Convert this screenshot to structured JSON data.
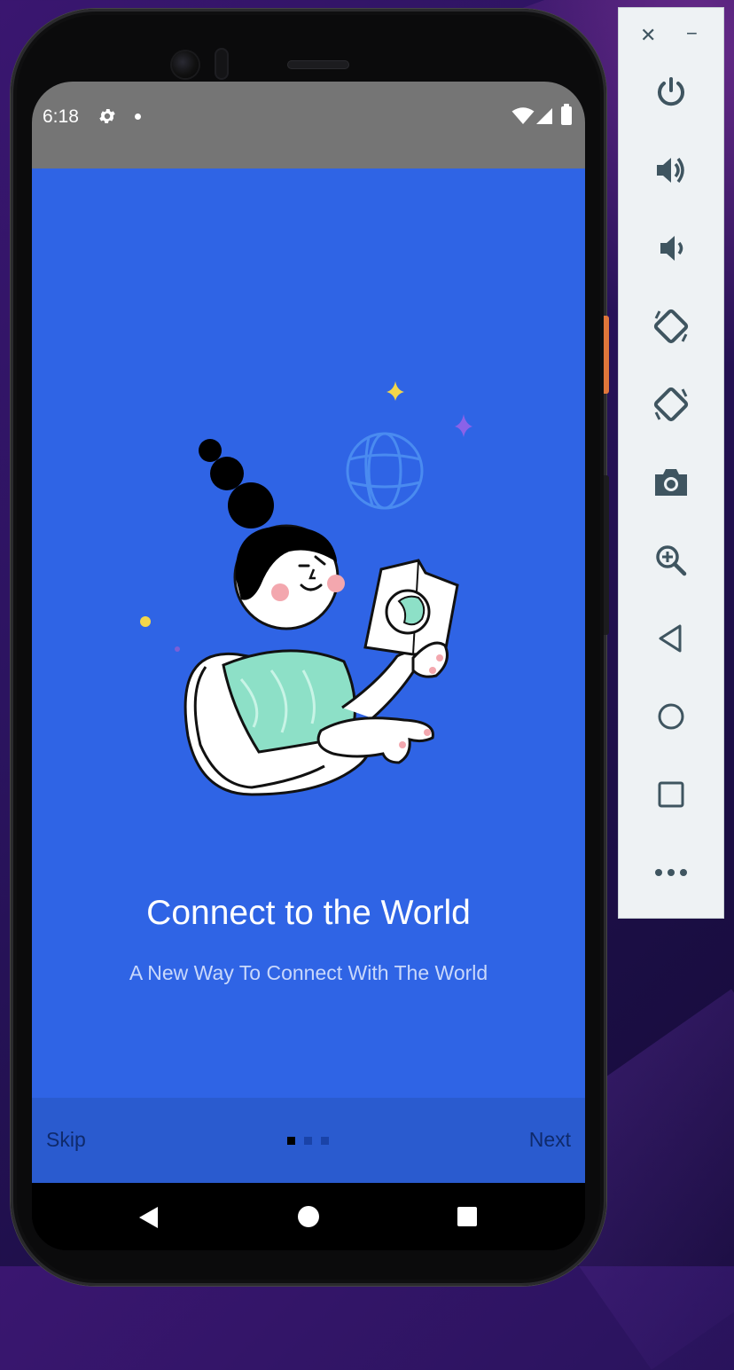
{
  "status_bar": {
    "time": "6:18"
  },
  "onboarding": {
    "title": "Connect to the World",
    "subtitle": "A New Way To Connect With The World",
    "current_page": 1,
    "total_pages": 3
  },
  "bottom_bar": {
    "skip_label": "Skip",
    "next_label": "Next"
  },
  "emulator_panel": {
    "tools": [
      "power-icon",
      "volume-up-icon",
      "volume-down-icon",
      "rotate-left-icon",
      "rotate-right-icon",
      "camera-icon",
      "zoom-icon",
      "back-icon",
      "home-icon",
      "overview-icon",
      "more-icon"
    ]
  },
  "colors": {
    "screen_bg": "#2f64e5",
    "bottom_bar_bg": "#2a5bcf",
    "status_bar_bg": "#757575",
    "accent_text": "#0f2a6b"
  }
}
